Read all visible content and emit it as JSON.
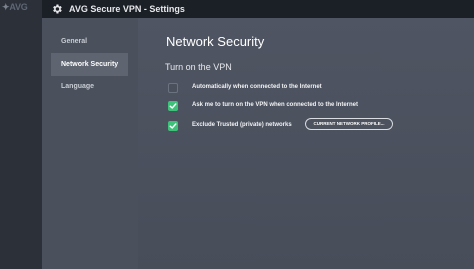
{
  "background": {
    "logo_text": "AVG"
  },
  "window": {
    "title": "AVG Secure VPN - Settings"
  },
  "sidebar": {
    "items": [
      {
        "label": "General"
      },
      {
        "label": "Network Security"
      },
      {
        "label": "Language"
      }
    ],
    "active_index": 1
  },
  "main": {
    "title": "Network Security",
    "section_title": "Turn on the VPN",
    "options": [
      {
        "label": "Automatically when connected to the Internet",
        "checked": false
      },
      {
        "label": "Ask me to turn on the VPN when connected to the Internet",
        "checked": true
      },
      {
        "label": "Exclude Trusted (private) networks",
        "checked": true
      }
    ],
    "profile_button": "CURRENT NETWORK PROFILE..."
  },
  "colors": {
    "accent_check": "#3ec27a",
    "titlebar": "#1b1f26",
    "sidebar": "#4a505c",
    "content": "#4f5562"
  }
}
